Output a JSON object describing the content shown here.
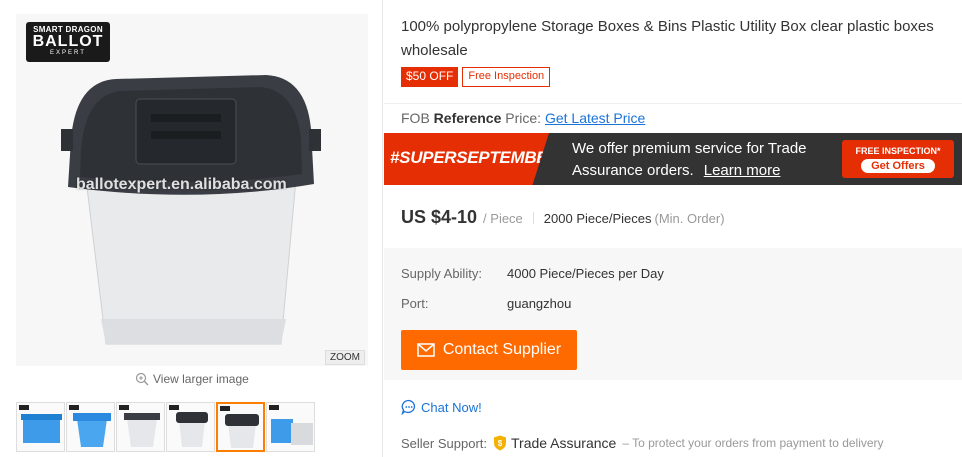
{
  "gallery": {
    "logo": {
      "line1": "SMART DRAGON",
      "line2": "BALLOT",
      "line3": "EXPERT"
    },
    "watermark": "ballotexpert.en.alibaba.com",
    "zoom_label": "ZOOM",
    "view_larger_label": "View larger image",
    "thumbnails": [
      {
        "name": "thumb-1",
        "active": false
      },
      {
        "name": "thumb-2",
        "active": false
      },
      {
        "name": "thumb-3",
        "active": false
      },
      {
        "name": "thumb-4",
        "active": false
      },
      {
        "name": "thumb-5",
        "active": true
      },
      {
        "name": "thumb-6",
        "active": false
      }
    ]
  },
  "product": {
    "title": "100% polypropylene Storage Boxes & Bins Plastic Utility Box clear plastic boxes wholesale",
    "badge_off": "$50 OFF",
    "badge_inspection": "Free Inspection",
    "fob_prefix": "FOB",
    "fob_bold": "Reference",
    "fob_suffix": "Price:",
    "fob_link": "Get Latest Price"
  },
  "banner": {
    "campaign": "#SUPERSEPTEMBER",
    "line1": "We offer premium service for Trade",
    "line2": "Assurance orders.",
    "learn_more": "Learn more",
    "inspection_label": "FREE INSPECTION*",
    "offers_button": "Get Offers"
  },
  "pricing": {
    "price": "US $4-10",
    "unit": "/ Piece",
    "moq": "2000 Piece/Pieces",
    "moq_note": "(Min. Order)"
  },
  "info": {
    "supply_label": "Supply Ability:",
    "supply_value": "4000 Piece/Pieces per Day",
    "port_label": "Port:",
    "port_value": "guangzhou",
    "contact_button": "Contact Supplier"
  },
  "support": {
    "chat_label": "Chat Now!",
    "seller_support_label": "Seller Support:",
    "trade_assurance": "Trade Assurance",
    "trade_assurance_note": "– To protect your orders from payment to delivery"
  },
  "colors": {
    "accent_orange": "#ff6a00",
    "accent_red": "#e62e04",
    "link_blue": "#1a73d9"
  }
}
